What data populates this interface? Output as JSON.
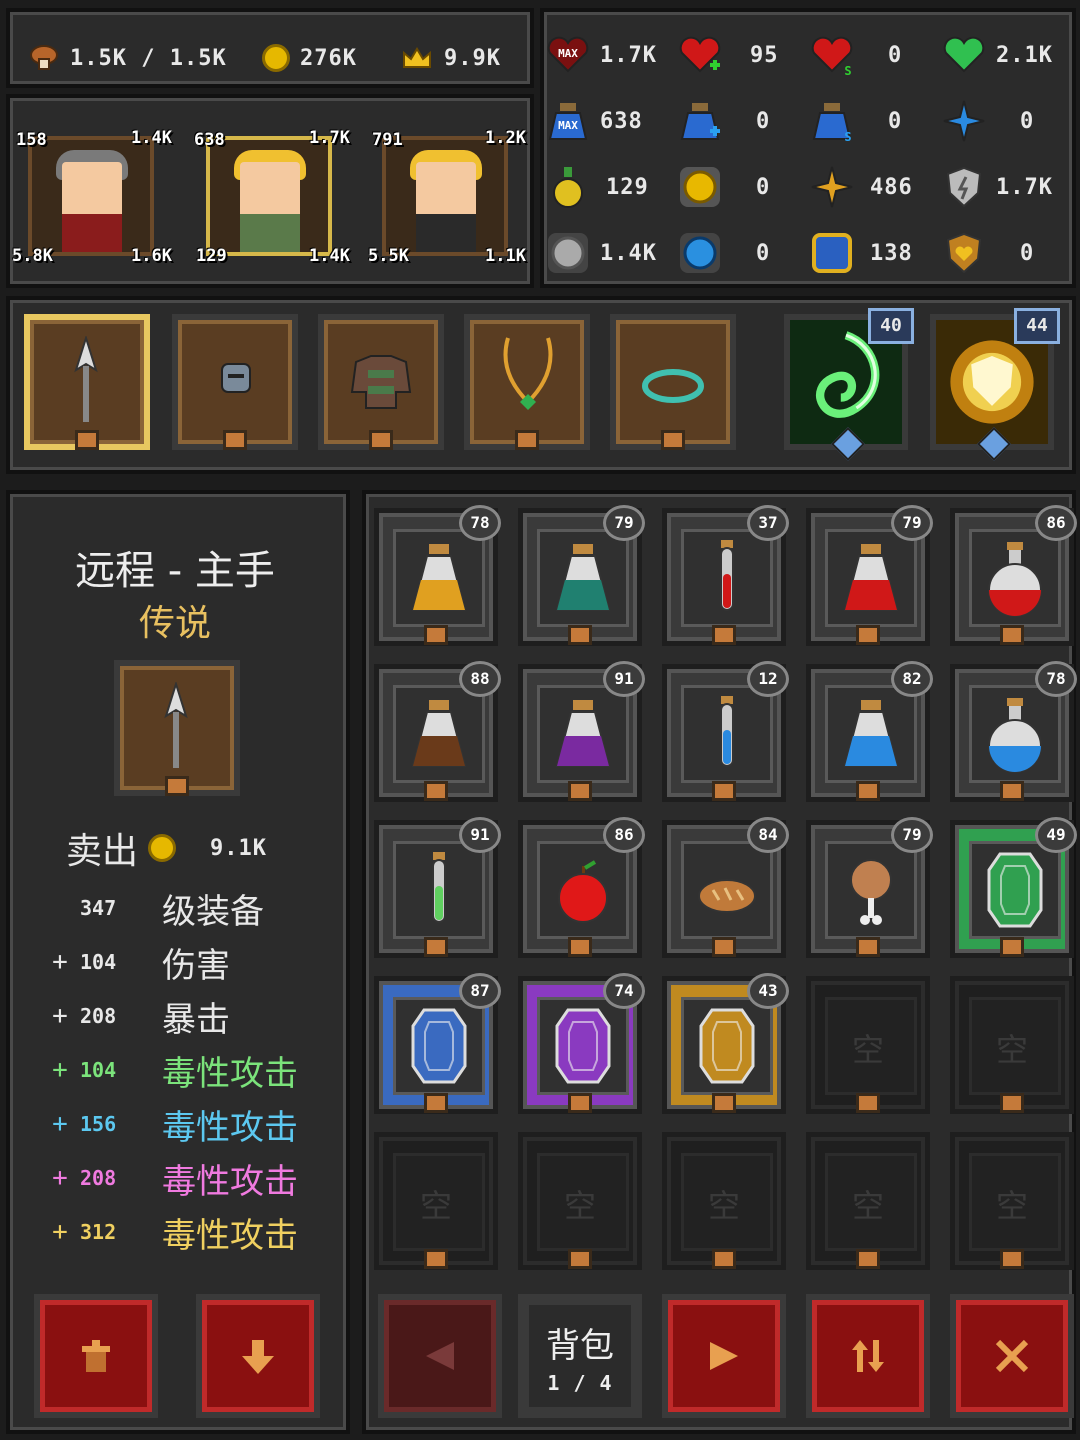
{
  "resources": {
    "stamina": "1.5K / 1.5K",
    "gold": "276K",
    "crowns": "9.9K"
  },
  "heroes": [
    {
      "name": "warrior",
      "tl": "158",
      "tr": "1.4K",
      "bl": "5.8K",
      "br": "1.6K"
    },
    {
      "name": "blonde-fighter",
      "tl": "638",
      "tr": "1.7K",
      "bl": "129",
      "br": "1.4K"
    },
    {
      "name": "blonde-maid",
      "tl": "791",
      "tr": "1.2K",
      "bl": "5.5K",
      "br": "1.1K"
    }
  ],
  "stats": [
    [
      "1.7K",
      "95",
      "0",
      "2.1K"
    ],
    [
      "638",
      "0",
      "0",
      "0"
    ],
    [
      "129",
      "0",
      "486",
      "1.7K"
    ],
    [
      "1.4K",
      "0",
      "138",
      "0"
    ]
  ],
  "stat_max_label": "MAX",
  "skills": {
    "green": "40",
    "gold": "44"
  },
  "item": {
    "slot": "远程 - 主手",
    "rarity": "传说",
    "sell_label": "卖出",
    "sell_price": "9.1K",
    "level_num": "347",
    "level_label": "级装备",
    "attrs": [
      {
        "plus": "+",
        "num": "104",
        "name": "伤害",
        "color": "#ffffff"
      },
      {
        "plus": "+",
        "num": "208",
        "name": "暴击",
        "color": "#ffffff"
      },
      {
        "plus": "+",
        "num": "104",
        "name": "毒性攻击",
        "color": "#7be37b"
      },
      {
        "plus": "+",
        "num": "156",
        "name": "毒性攻击",
        "color": "#5cc8f0"
      },
      {
        "plus": "+",
        "num": "208",
        "name": "毒性攻击",
        "color": "#f07ae0"
      },
      {
        "plus": "+",
        "num": "312",
        "name": "毒性攻击",
        "color": "#f0d060"
      }
    ]
  },
  "inventory": {
    "levels": [
      "78",
      "79",
      "37",
      "79",
      "86",
      "88",
      "91",
      "12",
      "82",
      "78",
      "91",
      "86",
      "84",
      "79",
      "49",
      "87",
      "74",
      "43"
    ],
    "empty_label": "空"
  },
  "bag": {
    "label": "背包",
    "page": "1 / 4"
  }
}
